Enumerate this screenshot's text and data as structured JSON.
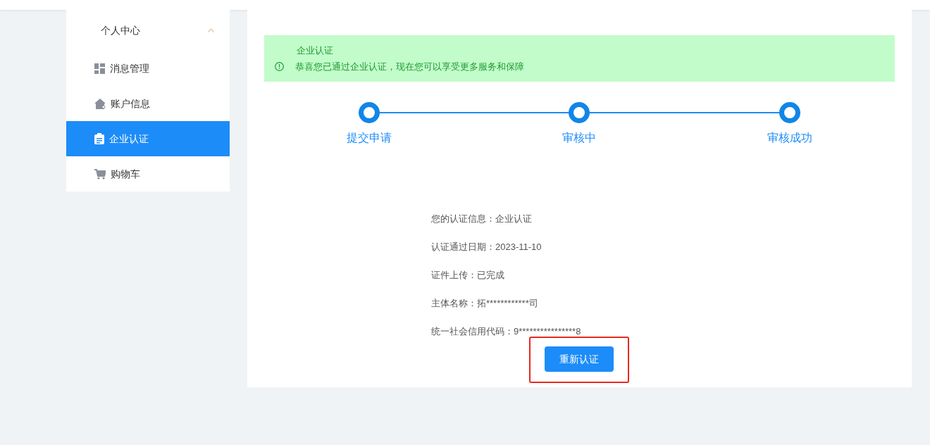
{
  "sidebar": {
    "header": {
      "label": "个人中心",
      "expanded": true
    },
    "items": [
      {
        "label": "消息管理",
        "selected": false
      },
      {
        "label": "账户信息",
        "selected": false
      },
      {
        "label": "企业认证",
        "selected": true
      },
      {
        "label": "购物车",
        "selected": false
      }
    ]
  },
  "alert": {
    "title": "企业认证",
    "message": "恭喜您已通过企业认证，现在您可以享受更多服务和保障"
  },
  "steps": [
    {
      "label": "提交申请",
      "done": true
    },
    {
      "label": "审核中",
      "done": true
    },
    {
      "label": "审核成功",
      "done": true
    }
  ],
  "info": [
    "您的认证信息：企业认证",
    "认证通过日期：2023-11-10",
    "证件上传：已完成",
    "主体名称：拓************司",
    "统一社会信用代码：9****************8"
  ],
  "button": {
    "label": "重新认证",
    "highlighted": true
  }
}
